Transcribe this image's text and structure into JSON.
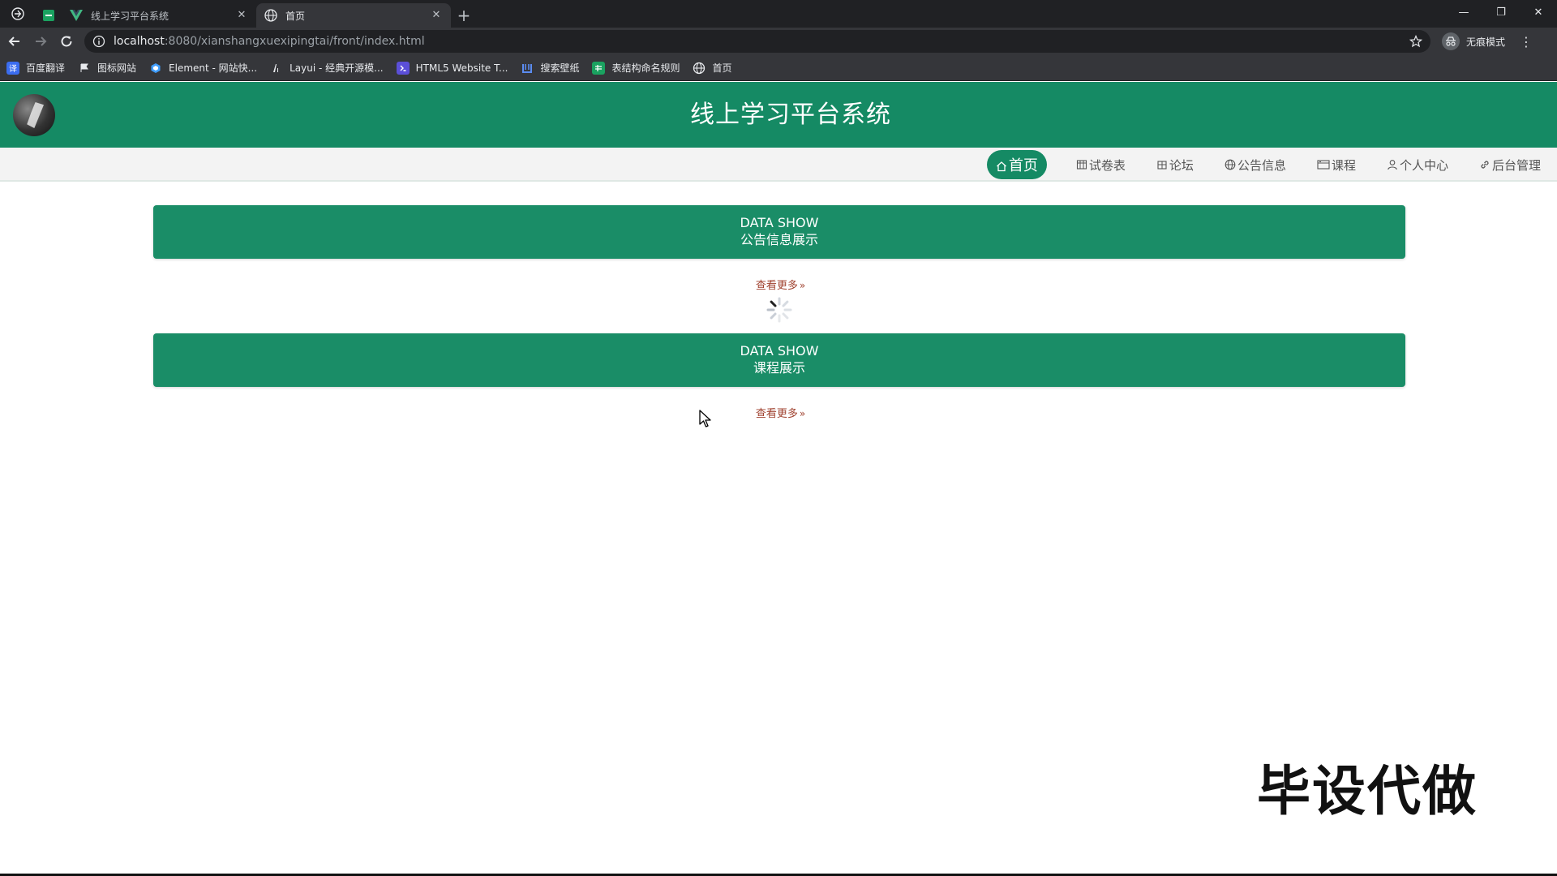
{
  "browser": {
    "tabs": [
      {
        "title": "线上学习平台系统",
        "favicon": "vue-icon",
        "active": false
      },
      {
        "title": "首页",
        "favicon": "globe-icon",
        "active": true
      }
    ],
    "address": {
      "host": "localhost",
      "path": ":8080/xianshangxuexipingtai/front/index.html"
    },
    "profile_label": "无痕模式",
    "bookmarks": [
      {
        "label": "百度翻译",
        "icon": "translate-icon",
        "color": "#3b6df0"
      },
      {
        "label": "图标网站",
        "icon": "flag-icon",
        "color": "#555555"
      },
      {
        "label": "Element - 网站快...",
        "icon": "element-icon",
        "color": "#409eff"
      },
      {
        "label": "Layui - 经典开源模...",
        "icon": "layui-icon",
        "color": "#555555"
      },
      {
        "label": "HTML5 Website T...",
        "icon": "html5-icon",
        "color": "#5b4fd8"
      },
      {
        "label": "搜索壁纸",
        "icon": "wallpaper-icon",
        "color": "#3b6df0"
      },
      {
        "label": "表结构命名规则",
        "icon": "sheet-icon",
        "color": "#1aa260"
      },
      {
        "label": "首页",
        "icon": "globe-icon",
        "color": "#555555"
      }
    ]
  },
  "site": {
    "title": "线上学习平台系统",
    "nav": [
      {
        "label": "首页",
        "icon": "home-icon",
        "active": true
      },
      {
        "label": "试卷表",
        "icon": "exam-icon",
        "active": false
      },
      {
        "label": "论坛",
        "icon": "forum-icon",
        "active": false
      },
      {
        "label": "公告信息",
        "icon": "globe-icon",
        "active": false
      },
      {
        "label": "课程",
        "icon": "course-icon",
        "active": false
      },
      {
        "label": "个人中心",
        "icon": "user-icon",
        "active": false
      },
      {
        "label": "后台管理",
        "icon": "link-icon",
        "active": false
      }
    ],
    "sections": [
      {
        "en": "DATA SHOW",
        "cn": "公告信息展示",
        "more": "查看更多"
      },
      {
        "en": "DATA SHOW",
        "cn": "课程展示",
        "more": "查看更多"
      }
    ],
    "accent": "#158a64",
    "link_color": "#a0422f"
  },
  "watermark": "毕设代做"
}
